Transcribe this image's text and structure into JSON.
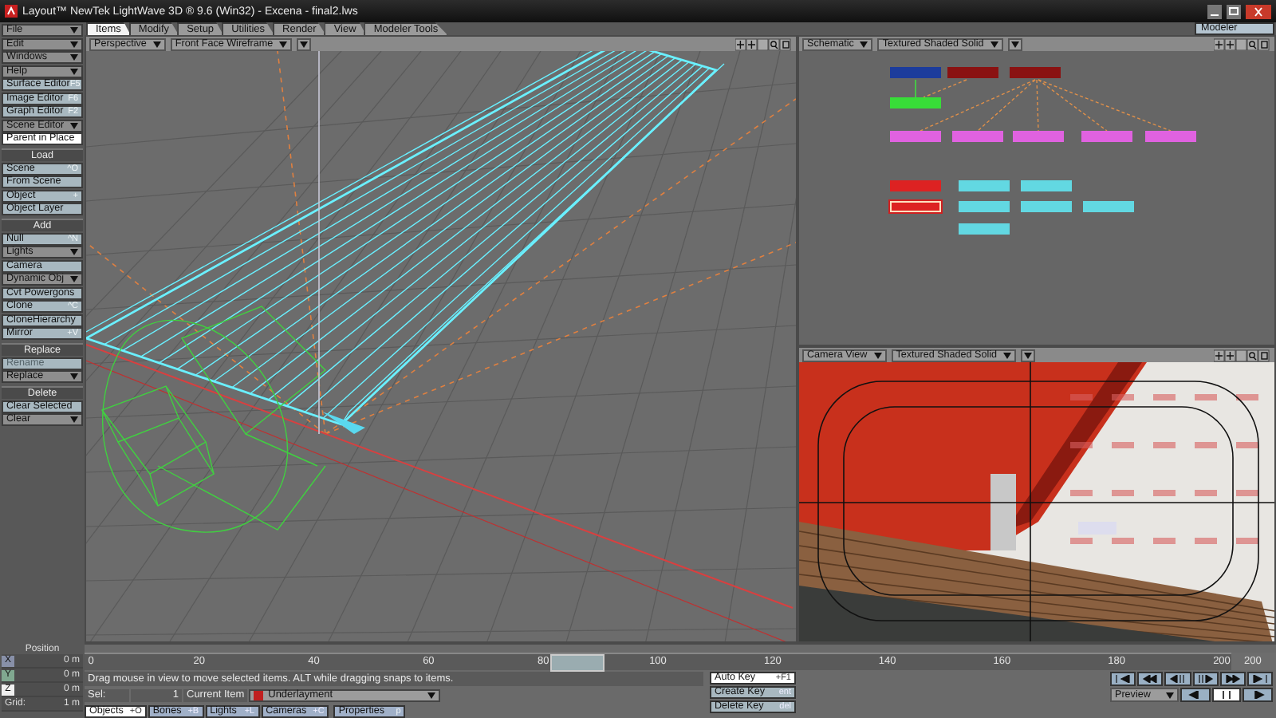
{
  "window": {
    "title": "Layout™ NewTek LightWave 3D ® 9.6  (Win32) - Excena - final2.lws"
  },
  "menu_tabs": [
    {
      "label": "Items",
      "selected": true
    },
    {
      "label": "Modify",
      "selected": false
    },
    {
      "label": "Setup",
      "selected": false
    },
    {
      "label": "Utilities",
      "selected": false
    },
    {
      "label": "Render",
      "selected": false
    },
    {
      "label": "View",
      "selected": false
    },
    {
      "label": "Modeler Tools",
      "selected": false
    }
  ],
  "modeler_button": {
    "label": "Modeler"
  },
  "sidebar": [
    {
      "kind": "dropdown",
      "label": "File",
      "disabled": false
    },
    {
      "kind": "dropdown",
      "label": "Edit",
      "disabled": false
    },
    {
      "kind": "dropdown",
      "label": "Windows",
      "disabled": false
    },
    {
      "kind": "dropdown",
      "label": "Help",
      "disabled": false
    },
    {
      "kind": "command",
      "label": "Surface Editor",
      "shortcut": "F5",
      "disabled": false
    },
    {
      "kind": "command",
      "label": "Image Editor",
      "shortcut": "F6",
      "disabled": false
    },
    {
      "kind": "command",
      "label": "Graph Editor",
      "shortcut": "F2",
      "disabled": false
    },
    {
      "kind": "dropdown",
      "label": "Scene Editor",
      "disabled": false
    },
    {
      "kind": "toggle",
      "label": "Parent in Place",
      "on": true,
      "disabled": false
    },
    {
      "kind": "header",
      "label": "Load"
    },
    {
      "kind": "command",
      "label": "Scene",
      "shortcut": "^O",
      "disabled": false
    },
    {
      "kind": "command",
      "label": "From Scene",
      "disabled": false
    },
    {
      "kind": "command",
      "label": "Object",
      "shortcut": "+",
      "disabled": false
    },
    {
      "kind": "command",
      "label": "Object Layer",
      "disabled": false
    },
    {
      "kind": "header",
      "label": "Add"
    },
    {
      "kind": "command",
      "label": "Null",
      "shortcut": "^N",
      "disabled": false
    },
    {
      "kind": "dropdown",
      "label": "Lights",
      "disabled": false
    },
    {
      "kind": "command",
      "label": "Camera",
      "disabled": false
    },
    {
      "kind": "dropdown",
      "label": "Dynamic Obj",
      "disabled": false
    },
    {
      "kind": "command",
      "label": "Cvt Powergons",
      "disabled": false
    },
    {
      "kind": "command",
      "label": "Clone",
      "shortcut": "^C",
      "disabled": false
    },
    {
      "kind": "command",
      "label": "CloneHierarchy",
      "disabled": false
    },
    {
      "kind": "command",
      "label": "Mirror",
      "shortcut": "+V",
      "disabled": false
    },
    {
      "kind": "header",
      "label": "Replace"
    },
    {
      "kind": "command",
      "label": "Rename",
      "disabled": true
    },
    {
      "kind": "dropdown",
      "label": "Replace",
      "disabled": false
    },
    {
      "kind": "header",
      "label": "Delete"
    },
    {
      "kind": "command",
      "label": "Clear Selected",
      "disabled": false
    },
    {
      "kind": "dropdown",
      "label": "Clear",
      "disabled": false
    }
  ],
  "viewports": [
    {
      "kind": "perspective",
      "view": "Perspective",
      "mode": "Front Face Wireframe"
    },
    {
      "kind": "schematic",
      "view": "Schematic",
      "mode": "Textured Shaded Solid",
      "nodes": [
        {
          "color": "#1c3c9c",
          "selected": false
        },
        {
          "color": "#8a1212",
          "selected": false
        },
        {
          "color": "#8a1212",
          "selected": false
        },
        {
          "color": "#38dd38",
          "selected": false
        },
        {
          "color": "#e062e0",
          "selected": false
        },
        {
          "color": "#e062e0",
          "selected": false
        },
        {
          "color": "#e062e0",
          "selected": false
        },
        {
          "color": "#e062e0",
          "selected": false
        },
        {
          "color": "#e062e0",
          "selected": false
        },
        {
          "color": "#dd2222",
          "selected": false
        },
        {
          "color": "#62d8e2",
          "selected": false
        },
        {
          "color": "#62d8e2",
          "selected": false
        },
        {
          "color": "#dd2222",
          "selected": true
        },
        {
          "color": "#62d8e2",
          "selected": false
        },
        {
          "color": "#62d8e2",
          "selected": false
        },
        {
          "color": "#62d8e2",
          "selected": false
        },
        {
          "color": "#62d8e2",
          "selected": false
        }
      ]
    },
    {
      "kind": "camera",
      "view": "Camera View",
      "mode": "Textured Shaded Solid"
    }
  ],
  "position": {
    "title": "Position",
    "axes": [
      {
        "axis": "X",
        "value": "0 m"
      },
      {
        "axis": "Y",
        "value": "0 m"
      },
      {
        "axis": "Z",
        "value": "0 m"
      }
    ],
    "grid_label": "Grid:",
    "grid_value": "1 m"
  },
  "timeline": {
    "labels": [
      "0",
      "20",
      "40",
      "60",
      "80",
      "100",
      "120",
      "140",
      "160",
      "180",
      "200"
    ],
    "level": 0.43,
    "end_frame": "200"
  },
  "status_message": "Drag mouse in view to move selected items. ALT while dragging snaps to items.",
  "selection": {
    "label": "Sel:",
    "count": "1",
    "current_item_label": "Current Item",
    "current_item": "Underlayment"
  },
  "item_types": [
    {
      "label": "Objects",
      "shortcut": "+O",
      "selected": true
    },
    {
      "label": "Bones",
      "shortcut": "+B",
      "selected": false
    },
    {
      "label": "Lights",
      "shortcut": "+L",
      "selected": false
    },
    {
      "label": "Cameras",
      "shortcut": "+C",
      "selected": false
    }
  ],
  "properties_button": {
    "label": "Properties",
    "shortcut": "p"
  },
  "key_buttons": [
    {
      "label": "Auto Key",
      "shortcut": "+F1",
      "on": true
    },
    {
      "label": "Create Key",
      "shortcut": "ent",
      "on": false
    },
    {
      "label": "Delete Key",
      "shortcut": "del",
      "on": false
    }
  ],
  "preview": {
    "label": "Preview"
  }
}
